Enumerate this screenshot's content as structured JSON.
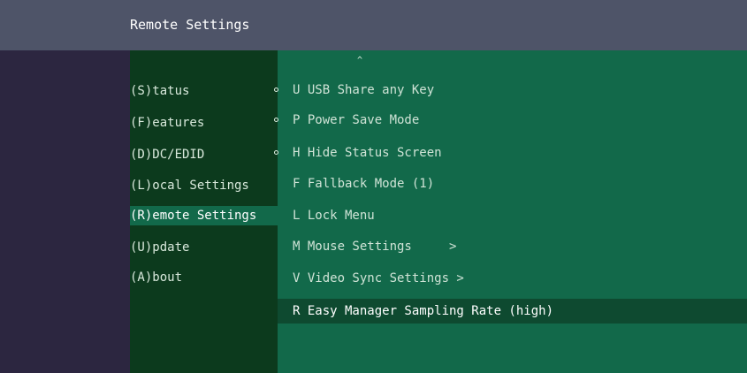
{
  "window": {
    "title": "Remote Settings"
  },
  "menu": {
    "items": [
      {
        "label": "(S)tatus",
        "selected": false
      },
      {
        "label": "(F)eatures",
        "selected": false
      },
      {
        "label": "(D)DC/EDID",
        "selected": false
      },
      {
        "label": "(L)ocal Settings",
        "selected": false
      },
      {
        "label": "(R)emote Settings",
        "selected": true
      },
      {
        "label": "(U)pdate",
        "selected": false
      },
      {
        "label": "(A)bout",
        "selected": false
      }
    ]
  },
  "settings": {
    "scroll_indicator": "^",
    "options": [
      {
        "text": "U USB Share any Key",
        "bullet": true,
        "highlight": false
      },
      {
        "text": "P Power Save Mode",
        "bullet": true,
        "highlight": false
      },
      {
        "text": "H Hide Status Screen",
        "bullet": true,
        "highlight": false
      },
      {
        "text": "F Fallback Mode (1)",
        "bullet": false,
        "highlight": false
      },
      {
        "text": "L Lock Menu",
        "bullet": false,
        "highlight": false
      },
      {
        "text": "M Mouse Settings     >",
        "bullet": false,
        "highlight": false
      },
      {
        "text": "V Video Sync Settings >",
        "bullet": false,
        "highlight": false
      },
      {
        "text": "R Easy Manager Sampling Rate (high)",
        "bullet": false,
        "highlight": true
      }
    ]
  }
}
